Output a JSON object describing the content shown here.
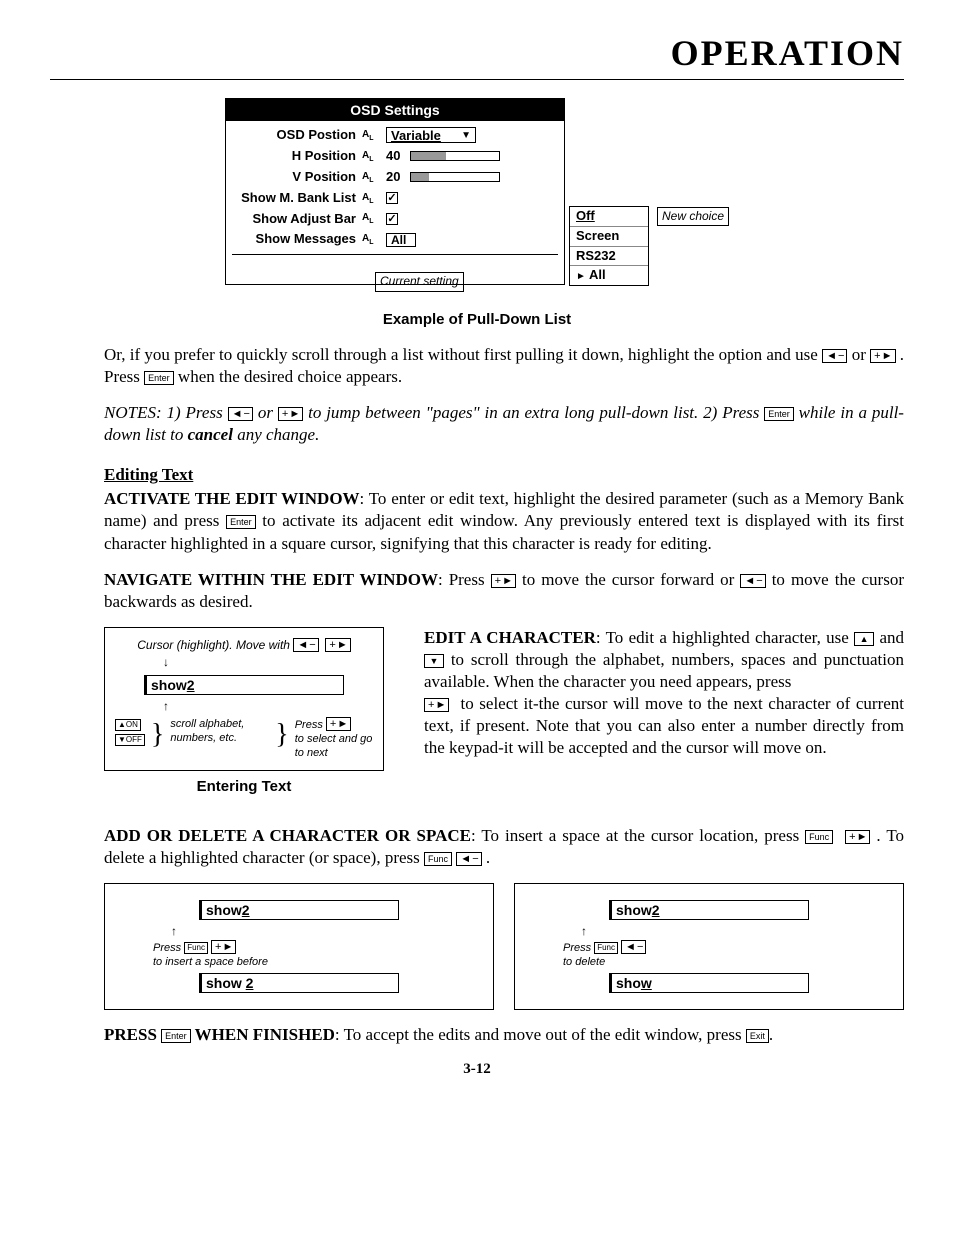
{
  "page": {
    "title": "OPERATION",
    "number": "3-12"
  },
  "osd": {
    "header": "OSD Settings",
    "rows": {
      "postion_label": "OSD Postion",
      "postion_value": "Variable",
      "hpos_label": "H Position",
      "hpos_value": "40",
      "vpos_label": "V Position",
      "vpos_value": "20",
      "bank_label": "Show M. Bank List",
      "adjust_label": "Show Adjust Bar",
      "messages_label": "Show Messages",
      "messages_value": "All"
    },
    "dropdown": [
      "Off",
      "Screen",
      "RS232",
      "All"
    ],
    "callout_new": "New choice",
    "callout_current": "Current setting",
    "caption": "Example of Pull-Down List"
  },
  "para1a": "Or, if you prefer to quickly scroll through a list without first pulling it down, highlight the option and use ",
  "para1b": " or ",
  "para1c": " . Press ",
  "para1d": " when the desired choice appears.",
  "notes_a": "NOTES: 1) Press ",
  "notes_b": " or ",
  "notes_c": " to jump between \"pages\" in an extra long pull-down list. 2) Press ",
  "notes_d": " while in a pull-down list to ",
  "notes_cancel": "cancel",
  "notes_e": " any change.",
  "sec_edit": "Editing Text",
  "activate_a": "ACTIVATE THE EDIT WINDOW",
  "activate_b": ": To enter or edit text, highlight the desired parameter (such as a Memory Bank name) and press ",
  "activate_c": " to activate its adjacent edit window. Any previously entered text is displayed with its first character highlighted in a square cursor, signifying that this character is ready for editing.",
  "nav_a": "NAVIGATE WITHIN THE EDIT WINDOW",
  "nav_b": ": Press ",
  "nav_c": " to move the cursor forward or ",
  "nav_d": " to move the cursor backwards as desired.",
  "entering_fig": {
    "line1a": "Cursor (highlight). Move with ",
    "show2": "show2",
    "scroll": "scroll alphabet, numbers, etc.",
    "press_sel": "Press ",
    "press_sel2": "to select and go to next",
    "caption": "Entering Text"
  },
  "editchar_a": "EDIT A CHARACTER",
  "editchar_b": ": To edit a highlighted character, use ",
  "editchar_c": " and ",
  "editchar_d": " to scroll through the alphabet, numbers, spaces and punctuation available. When the character you need appears, press",
  "editchar_e": " to select it-the cursor will move to the next character of current text, if present. Note that you can also enter a number directly from the keypad-it will be accepted and the cursor will move on.",
  "adddel_a": "ADD OR DELETE A CHARACTER OR SPACE",
  "adddel_b": ": To insert a space at the cursor location, press ",
  "adddel_c": " . To delete a highlighted character (or space), press ",
  "adddel_d": " .",
  "dual": {
    "left_show2": "show2",
    "left_press": "Press ",
    "left_note": "to insert a space before",
    "left_result": "show 2",
    "right_show2": "show2",
    "right_press": "Press ",
    "right_note": "to delete",
    "right_result": "show"
  },
  "finish_a": "PRESS ",
  "finish_b": " WHEN FINISHED",
  "finish_c": ": To accept the edits and move out of the edit window, press ",
  "finish_d": ".",
  "keys": {
    "left_minus": "◄ −",
    "plus_right": "+ ►",
    "enter": "Enter",
    "func": "Func",
    "exit": "Exit",
    "up": "▲",
    "down": "▼",
    "up_on": "▲ON",
    "down_off": "▼OFF"
  }
}
